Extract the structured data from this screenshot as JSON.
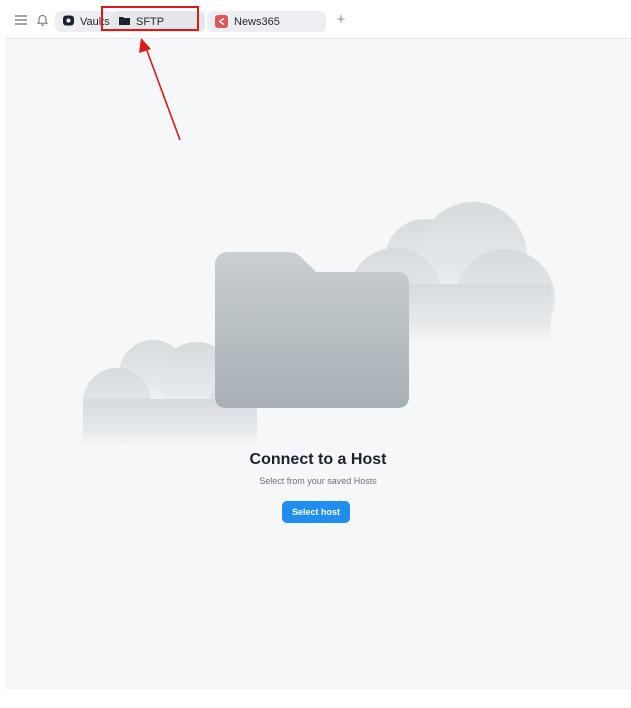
{
  "topbar": {
    "menu_icon": "hamburger-menu-icon",
    "bell_icon": "bell-icon",
    "tabs": [
      {
        "label": "Vaults",
        "icon": "vault-icon"
      },
      {
        "label": "SFTP",
        "icon": "folder-icon",
        "active": true
      },
      {
        "label": "News365",
        "icon": "host-app-icon",
        "icon_color": "#e05555"
      }
    ],
    "new_tab_icon": "plus-icon"
  },
  "main": {
    "title": "Connect to a Host",
    "subtitle": "Select from your saved Hosts",
    "button_label": "Select host",
    "button_color": "#1f8ef1"
  },
  "annotation": {
    "color": "#e01818"
  }
}
